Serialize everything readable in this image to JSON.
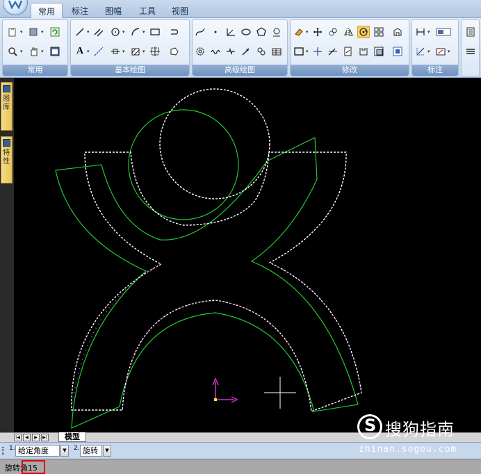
{
  "ribbon": {
    "tabs": [
      "常用",
      "标注",
      "图幅",
      "工具",
      "视图"
    ],
    "active_tab": "常用",
    "groups": [
      {
        "label": "常用"
      },
      {
        "label": "基本绘图"
      },
      {
        "label": "高级绘图"
      },
      {
        "label": "修改"
      },
      {
        "label": "标注"
      }
    ]
  },
  "palettes": {
    "layers": "图库",
    "properties": "特性"
  },
  "layout": {
    "model_tab": "模型",
    "nav": [
      "|◀",
      "◀",
      "▶",
      "▶|"
    ]
  },
  "command": {
    "option1_index": "1.",
    "option1_value": "给定角度",
    "option2_index": "2.",
    "option2_value": "旋转"
  },
  "status": {
    "prompt": "旋转角15"
  },
  "watermark": {
    "logo_char": "S",
    "brand": "搜狗指南",
    "url": "zhinan.sogou.com"
  },
  "colors": {
    "canvas": "#000000",
    "original_shape": "#22c934",
    "selected_shape": "#ffffff",
    "grips": "#d04bd8",
    "ucs": "#cc33cc",
    "highlight_box": "#e00000"
  }
}
